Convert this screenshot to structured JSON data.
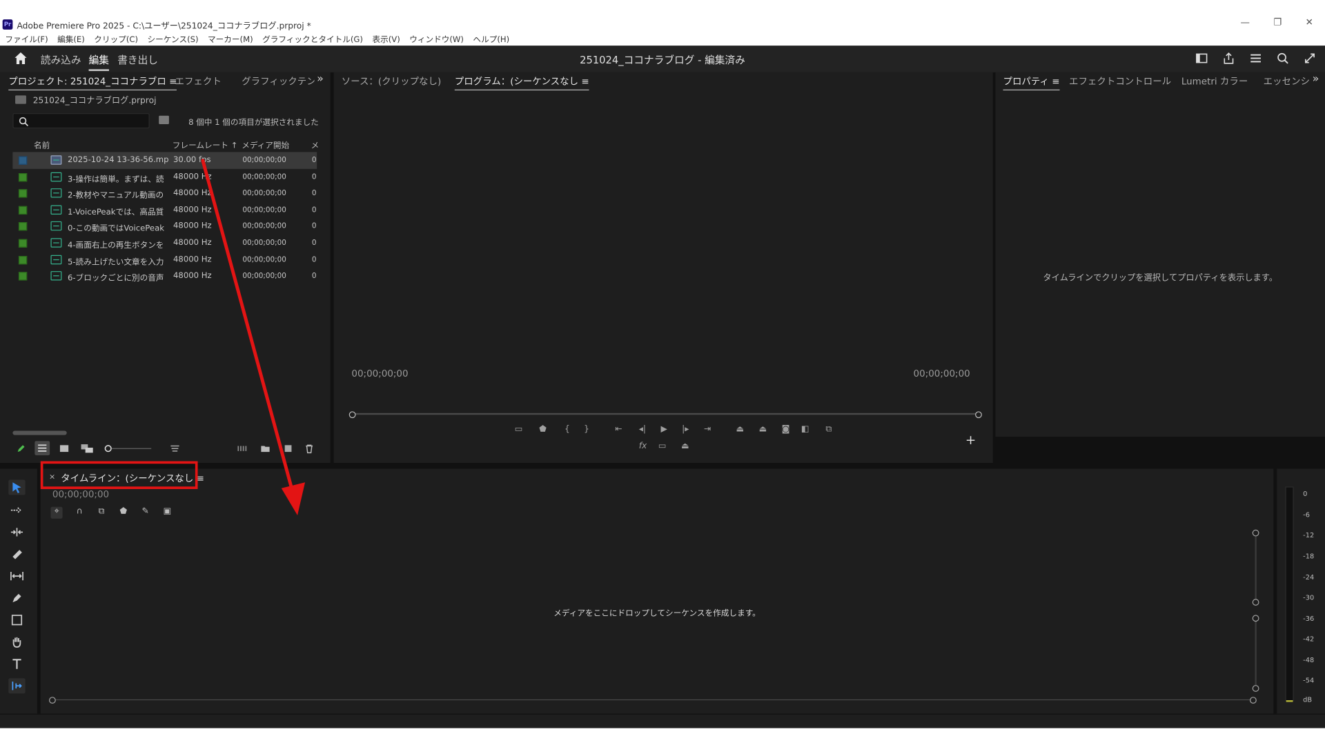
{
  "window": {
    "title": "Adobe Premiere Pro 2025 - C:\\ユーザー\\251024_ココナラブログ.prproj *",
    "controls": [
      "—",
      "❐",
      "✕"
    ]
  },
  "menu": [
    "ファイル(F)",
    "編集(E)",
    "クリップ(C)",
    "シーケンス(S)",
    "マーカー(M)",
    "グラフィックとタイトル(G)",
    "表示(V)",
    "ウィンドウ(W)",
    "ヘルプ(H)"
  ],
  "header": {
    "tabs": [
      "読み込み",
      "編集",
      "書き出し"
    ],
    "active_tab": "編集",
    "doc_title": "251024_ココナラブログ - 編集済み"
  },
  "project": {
    "tabs": [
      "プロジェクト: 251024_ココナラブロ ≡",
      "エフェクト",
      "グラフィックテンプ"
    ],
    "file": "251024_ココナラブログ.prproj",
    "selection": "8 個中 1 個の項目が選択されました",
    "columns": {
      "name": "名前",
      "framerate": "フレームレート ↑",
      "media_start": "メディア開始",
      "end": "メ"
    },
    "items": [
      {
        "name": "2025-10-24 13-36-56.mp",
        "rate": "30.00 fps",
        "start": "00;00;00;00",
        "end": "0",
        "selected": true
      },
      {
        "name": "3-操作は簡単。まずは、読",
        "rate": "48000 Hz",
        "start": "00;00;00;00",
        "end": "0"
      },
      {
        "name": "2-教材やマニュアル動画の",
        "rate": "48000 Hz",
        "start": "00;00;00;00",
        "end": "0"
      },
      {
        "name": "1-VoicePeakでは、高品質",
        "rate": "48000 Hz",
        "start": "00;00;00;00",
        "end": "0"
      },
      {
        "name": "0-この動画ではVoicePeak",
        "rate": "48000 Hz",
        "start": "00;00;00;00",
        "end": "0"
      },
      {
        "name": "4-画面右上の再生ボタンを",
        "rate": "48000 Hz",
        "start": "00;00;00;00",
        "end": "0"
      },
      {
        "name": "5-読み上げたい文章を入力",
        "rate": "48000 Hz",
        "start": "00;00;00;00",
        "end": "0"
      },
      {
        "name": "6-ブロックごとに別の音声",
        "rate": "48000 Hz",
        "start": "00;00;00;00",
        "end": "0"
      }
    ]
  },
  "program": {
    "tabs": [
      "ソース：(クリップなし)",
      "プログラム：(シーケンスなし ≡"
    ],
    "tc_left": "00;00;00;00",
    "tc_right": "00;00;00;00",
    "fx_label": "fx",
    "add_button": "+"
  },
  "properties": {
    "tabs": [
      "プロパティ ≡",
      "エフェクトコントロール",
      "Lumetri カラー",
      "エッセンシ"
    ],
    "message": "タイムラインでクリップを選択してプロパティを表示します。"
  },
  "timeline": {
    "tab": "タイムライン：(シーケンスなし ≡",
    "close": "×",
    "timecode": "00;00;00;00",
    "message": "メディアをここにドロップしてシーケンスを作成します。"
  },
  "meters": {
    "scale": [
      "0",
      "-6",
      "-12",
      "-18",
      "-24",
      "-30",
      "-36",
      "-42",
      "-48",
      "-54",
      "dB"
    ]
  },
  "colors": {
    "highlight_box": "#e31414",
    "arrow": "#e31414",
    "label_green": "#3c8a28",
    "label_blue": "#2c5e86"
  }
}
